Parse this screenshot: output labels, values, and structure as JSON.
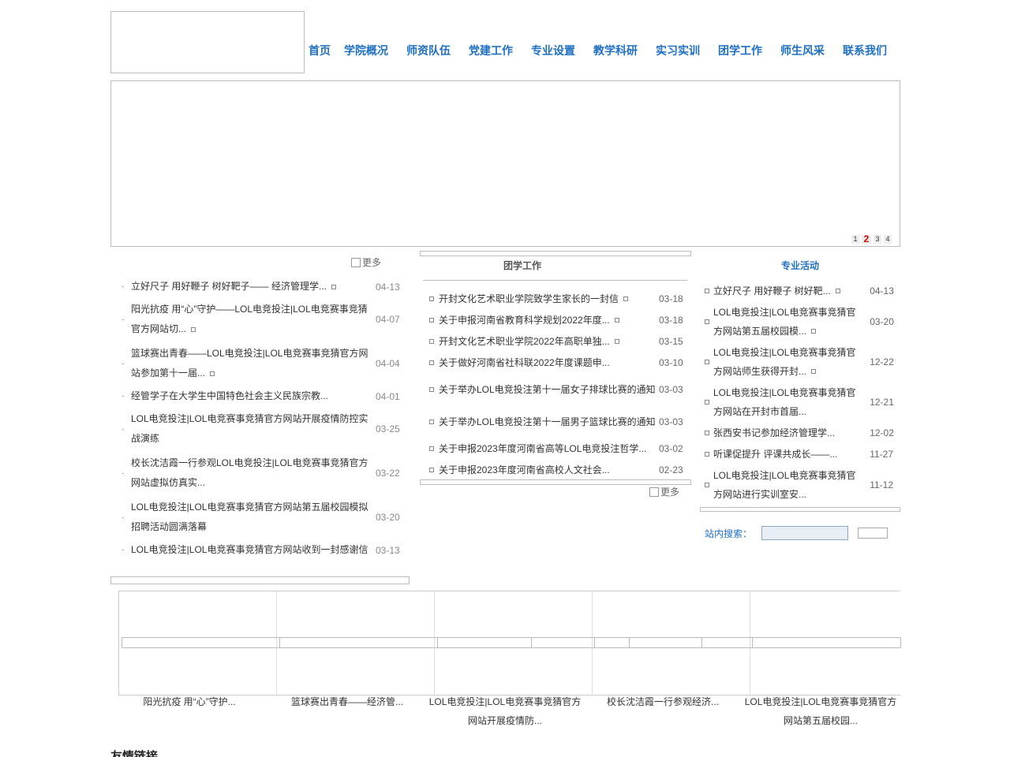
{
  "nav": [
    "首页",
    "学院概况",
    "师资队伍",
    "党建工作",
    "专业设置",
    "教学科研",
    "实习实训",
    "团学工作",
    "师生风采",
    "联系我们"
  ],
  "banner": {
    "pages": [
      "1",
      "2",
      "3",
      "4"
    ],
    "active": "2"
  },
  "left_news": {
    "more": "更多",
    "items": [
      {
        "title": "立好尺子 用好鞭子 树好靶子—— 经济管理学...",
        "date": "04-13",
        "mini": true
      },
      {
        "title": "阳光抗疫 用“心”守护——LOL电竞投注|LOL电竞赛事竞猜官方网站切...",
        "date": "04-07",
        "mini": true
      },
      {
        "title": "篮球赛出青春——LOL电竞投注|LOL电竞赛事竞猜官方网站参加第十一届...",
        "date": "04-04",
        "mini": true
      },
      {
        "title": "经管学子在大学生中国特色社会主义民族宗教...",
        "date": "04-01",
        "mini": false
      },
      {
        "title": "LOL电竞投注|LOL电竞赛事竞猜官方网站开展疫情防控实战演练",
        "date": "03-25",
        "mini": false
      },
      {
        "title": "校长沈洁霞一行参观LOL电竞投注|LOL电竞赛事竞猜官方网站虚拟仿真实...",
        "date": "03-22",
        "mini": false
      },
      {
        "title": "LOL电竞投注|LOL电竞赛事竞猜官方网站第五届校园模拟招聘活动圆满落幕",
        "date": "03-20",
        "mini": false
      },
      {
        "title": "LOL电竞投注|LOL电竞赛事竞猜官方网站收到一封感谢信",
        "date": "03-13",
        "mini": false
      }
    ]
  },
  "mid_news": {
    "title": "团学工作",
    "more": "更多",
    "items": [
      {
        "title": "开封文化艺术职业学院致学生家长的一封信",
        "date": "03-18",
        "mini": true
      },
      {
        "title": "关于申报河南省教育科学规划2022年度...",
        "date": "03-18",
        "mini": true
      },
      {
        "title": "开封文化艺术职业学院2022年高职单独...",
        "date": "03-15",
        "mini": true
      },
      {
        "title": "关于做好河南省社科联2022年度课题申...",
        "date": "03-10",
        "mini": false
      },
      {
        "title": "关于举办LOL电竞投注第十一届女子排球比赛的通知",
        "date": "03-03",
        "mini": false
      },
      {
        "title": "关于举办LOL电竞投注第十一届男子篮球比赛的通知",
        "date": "03-03",
        "mini": false
      },
      {
        "title": "关于申报2023年度河南省高等LOL电竞投注哲学...",
        "date": "03-02",
        "mini": false
      },
      {
        "title": "关于申报2023年度河南省高校人文社会...",
        "date": "02-23",
        "mini": false
      }
    ]
  },
  "right_news": {
    "title": "专业活动",
    "items": [
      {
        "title": "立好尺子 用好鞭子 树好靶...",
        "date": "04-13",
        "mini": true
      },
      {
        "title": "LOL电竞投注|LOL电竞赛事竞猜官方网站第五届校园模...",
        "date": "03-20",
        "mini": true
      },
      {
        "title": "LOL电竞投注|LOL电竞赛事竞猜官方网站师生获得开封...",
        "date": "12-22",
        "mini": true
      },
      {
        "title": "LOL电竞投注|LOL电竞赛事竞猜官方网站在开封市首届...",
        "date": "12-21",
        "mini": false
      },
      {
        "title": "张西安书记参加经济管理学...",
        "date": "12-02",
        "mini": false
      },
      {
        "title": "听课促提升 评课共成长——...",
        "date": "11-27",
        "mini": false
      },
      {
        "title": "LOL电竞投注|LOL电竞赛事竞猜官方网站进行实训室安...",
        "date": "11-12",
        "mini": false
      }
    ]
  },
  "search": {
    "label": "站内搜索：",
    "value": "",
    "button": ""
  },
  "gallery": {
    "captions": [
      "阳光抗疫 用“心”守护...",
      "篮球赛出青春——经济管...",
      "LOL电竞投注|LOL电竞赛事竞猜官方网站开展疫情防...",
      "校长沈洁霞一行参观经济...",
      "LOL电竞投注|LOL电竞赛事竞猜官方网站第五届校园..."
    ]
  },
  "links_title": "友情链接"
}
